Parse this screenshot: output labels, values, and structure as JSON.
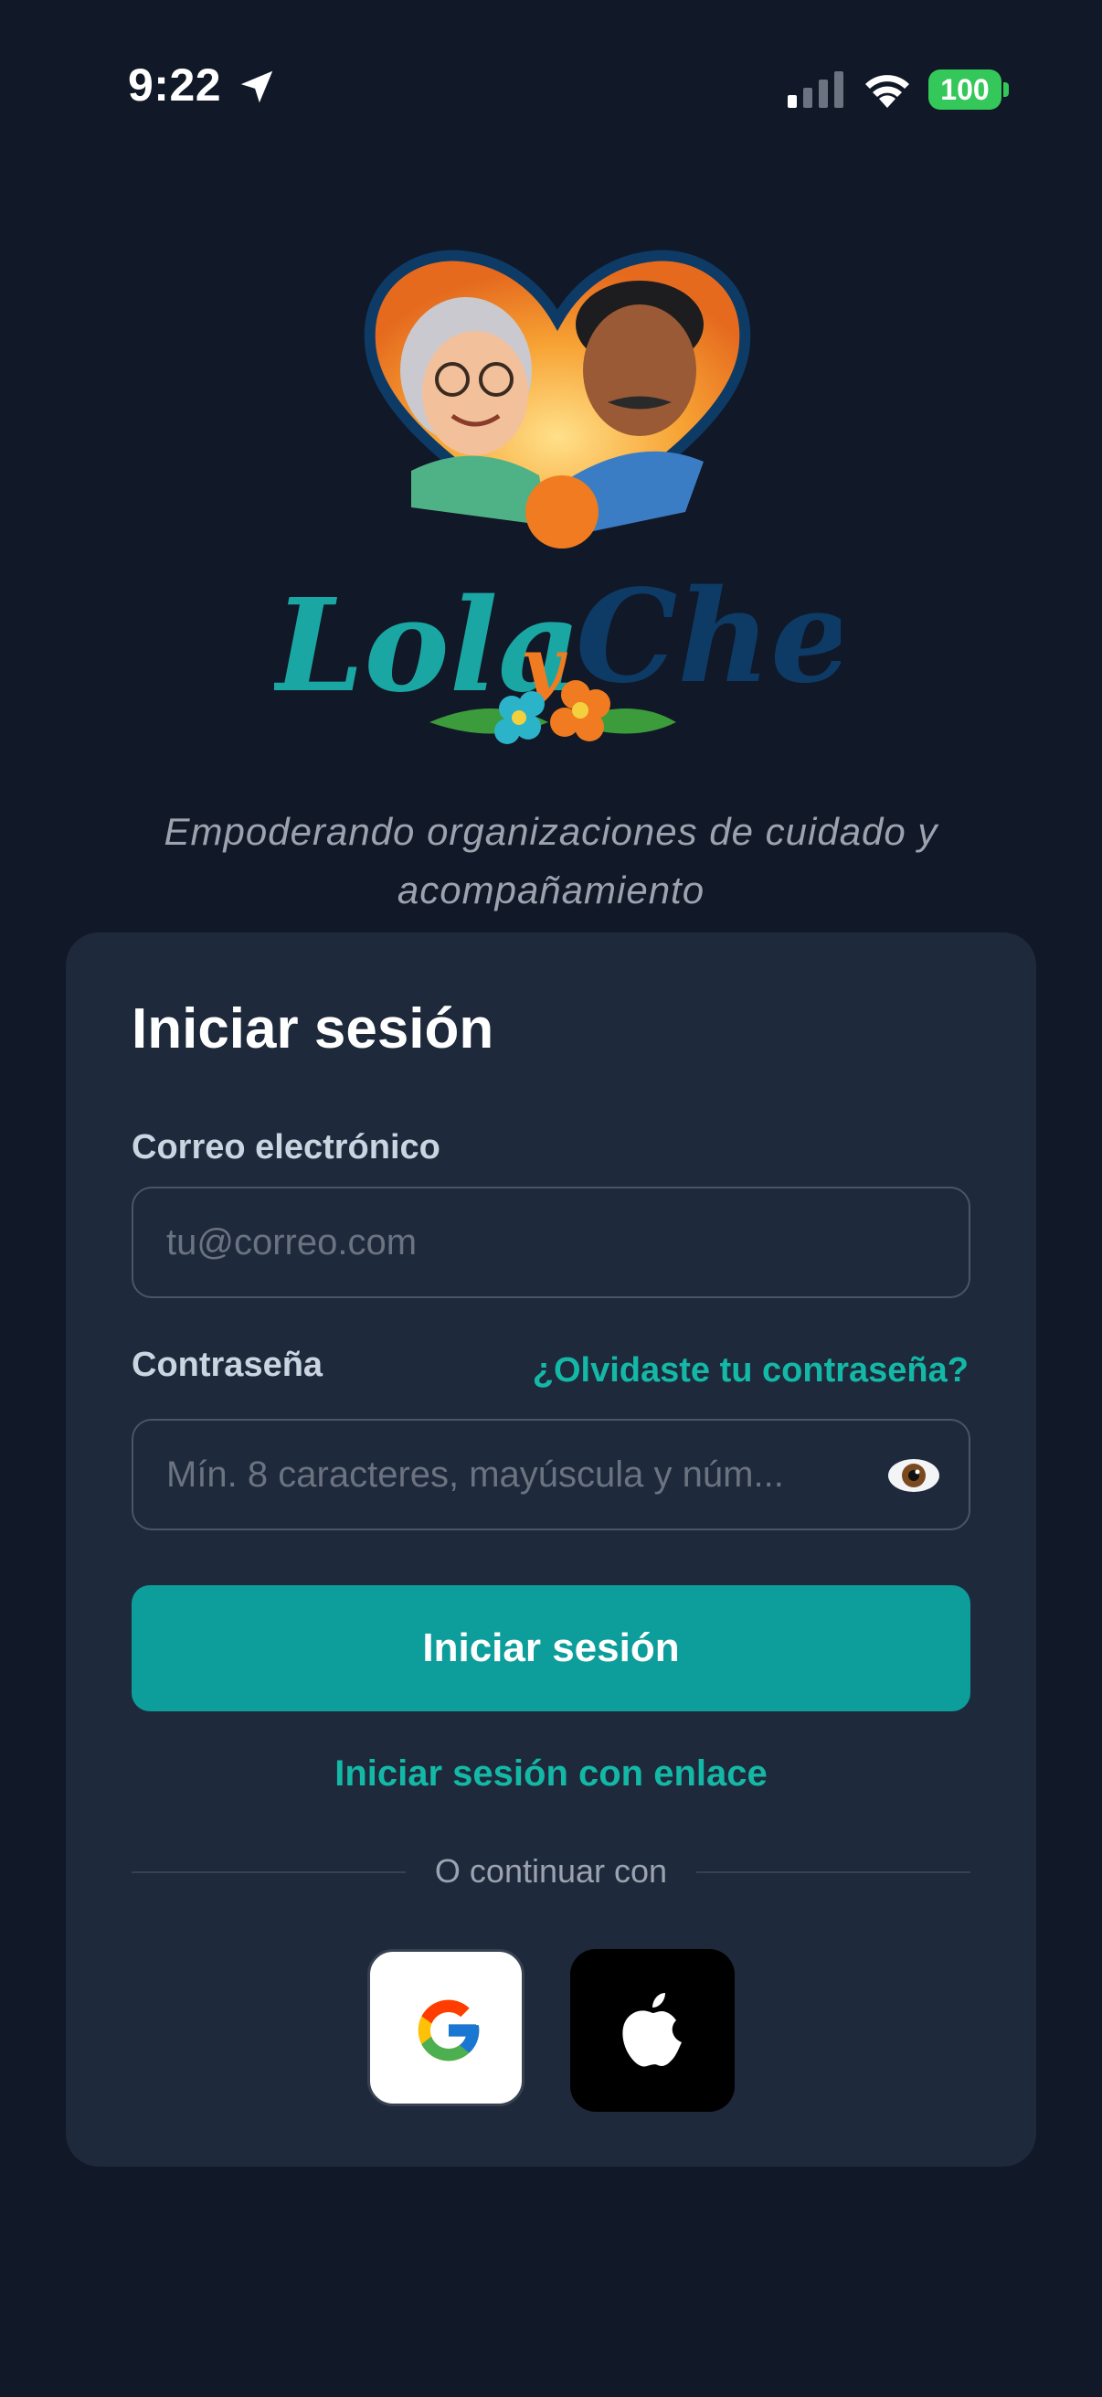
{
  "status_bar": {
    "time": "9:22",
    "battery": "100"
  },
  "logo": {
    "text_1": "Lola",
    "text_2": "y",
    "text_3": "Cheo"
  },
  "tagline": "Empoderando organizaciones de cuidado y acompañamiento",
  "login": {
    "title": "Iniciar sesión",
    "email_label": "Correo electrónico",
    "email_placeholder": "tu@correo.com",
    "password_label": "Contraseña",
    "forgot_password": "¿Olvidaste tu contraseña?",
    "password_placeholder": "Mín. 8 caracteres, mayúscula y núm...",
    "submit_label": "Iniciar sesión",
    "magic_link_label": "Iniciar sesión con enlace",
    "divider_text": "O continuar con"
  },
  "social": {
    "google_icon": "google-icon",
    "apple_icon": "apple-icon"
  },
  "colors": {
    "background": "#111827",
    "card": "#1e293b",
    "accent": "#0d9e9b",
    "link": "#14b8a6"
  }
}
